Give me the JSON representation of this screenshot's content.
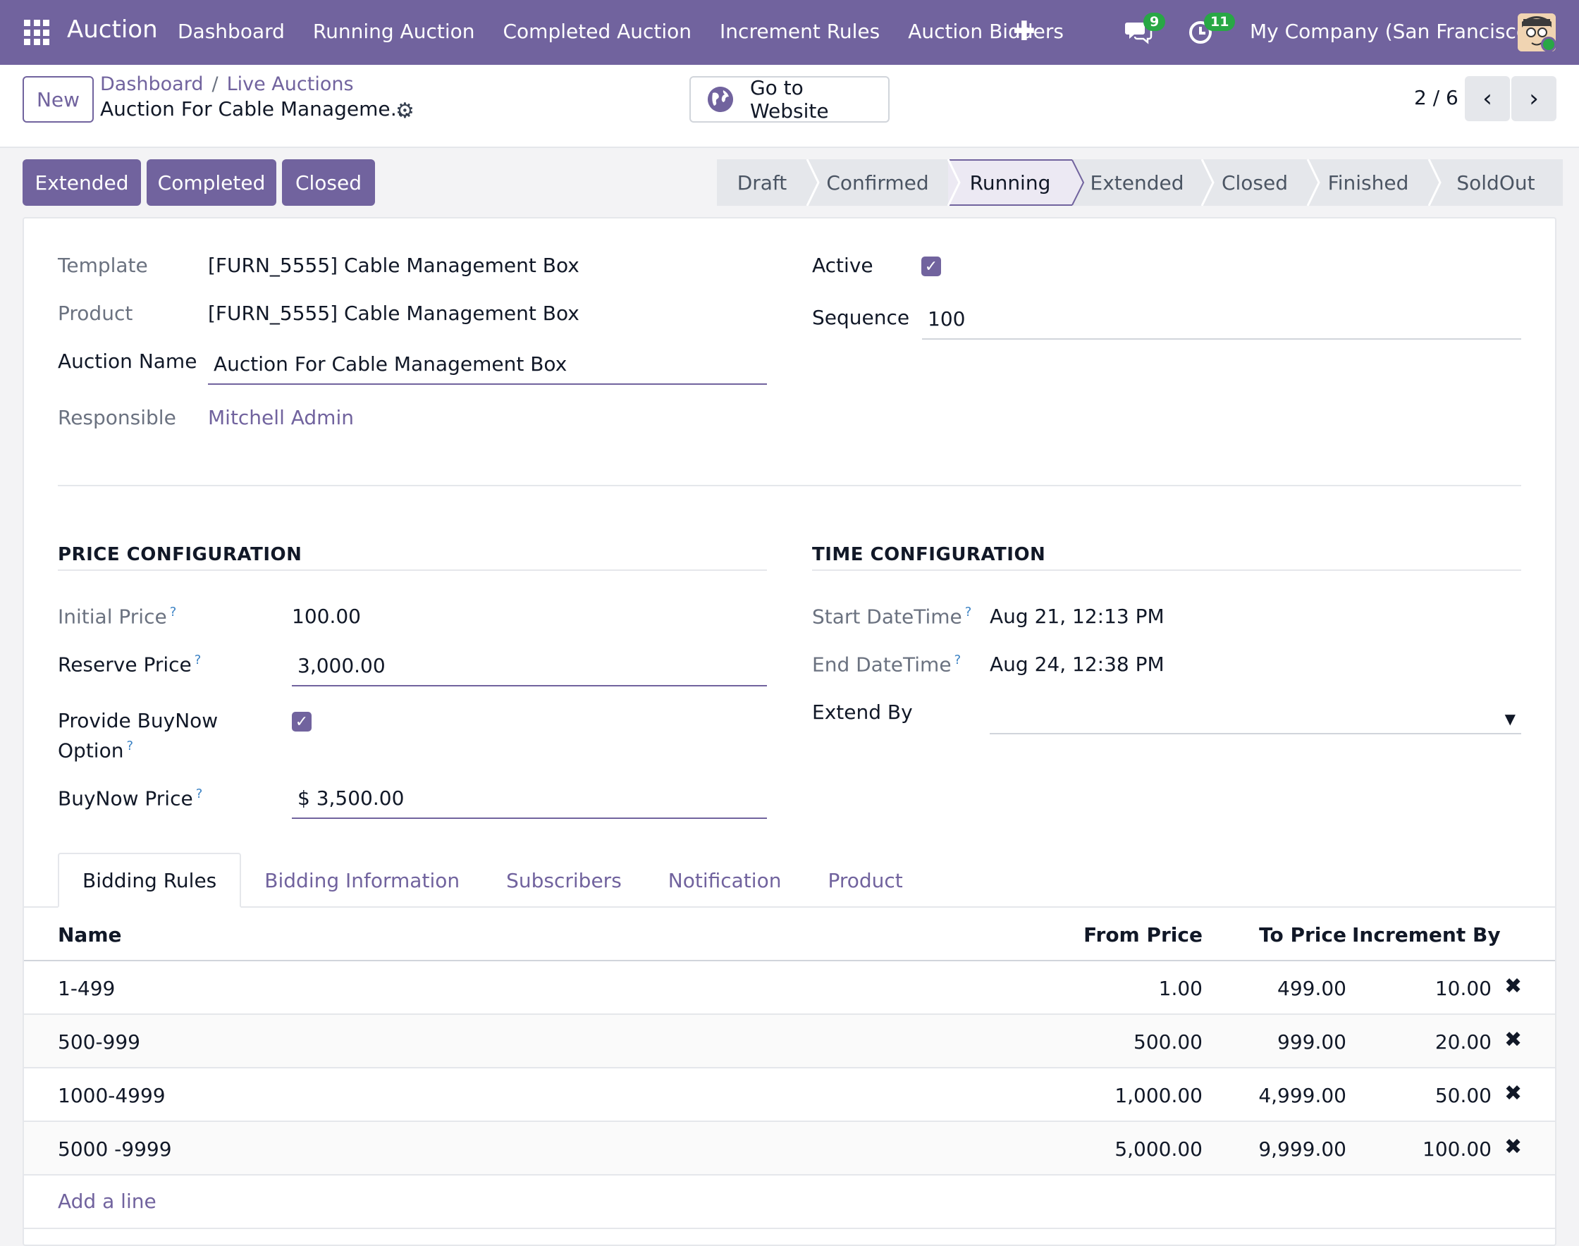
{
  "topnav": {
    "app_name": "Auction",
    "menu": [
      "Dashboard",
      "Running Auction",
      "Completed Auction",
      "Increment Rules",
      "Auction Bidders"
    ],
    "messages_count": "9",
    "activities_count": "11",
    "company": "My Company (San Francisco)"
  },
  "control": {
    "new_label": "New",
    "breadcrumb": [
      "Dashboard",
      "Live Auctions"
    ],
    "record_title": "Auction For Cable Manageme…",
    "website_label": "Go to Website",
    "pager": "2 / 6"
  },
  "actions": [
    "Extended",
    "Completed",
    "Closed"
  ],
  "stages": [
    "Draft",
    "Confirmed",
    "Running",
    "Extended",
    "Closed",
    "Finished",
    "SoldOut"
  ],
  "active_stage": "Running",
  "form": {
    "template_label": "Template",
    "template_value": "[FURN_5555] Cable Management Box",
    "product_label": "Product",
    "product_value": "[FURN_5555] Cable Management Box",
    "auction_name_label": "Auction Name",
    "auction_name_value": "Auction For Cable Management Box",
    "responsible_label": "Responsible",
    "responsible_value": "Mitchell Admin",
    "active_label": "Active",
    "active_checked": true,
    "sequence_label": "Sequence",
    "sequence_value": "100"
  },
  "price_config": {
    "title": "PRICE CONFIGURATION",
    "initial_price_label": "Initial Price",
    "initial_price_value": "100.00",
    "reserve_price_label": "Reserve Price",
    "reserve_price_value": "3,000.00",
    "buynow_option_label_1": "Provide BuyNow",
    "buynow_option_label_2": "Option",
    "buynow_checked": true,
    "buynow_price_label": "BuyNow Price",
    "buynow_price_value": "$ 3,500.00"
  },
  "time_config": {
    "title": "TIME CONFIGURATION",
    "start_label": "Start DateTime",
    "start_value": "Aug 21, 12:13 PM",
    "end_label": "End DateTime",
    "end_value": "Aug 24, 12:38 PM",
    "extend_label": "Extend By",
    "extend_value": ""
  },
  "tabs": [
    "Bidding Rules",
    "Bidding Information",
    "Subscribers",
    "Notification",
    "Product"
  ],
  "table": {
    "headers": {
      "name": "Name",
      "from": "From Price",
      "to": "To Price",
      "inc": "Increment By"
    },
    "rows": [
      {
        "name": "1-499",
        "from": "1.00",
        "to": "499.00",
        "inc": "10.00"
      },
      {
        "name": "500-999",
        "from": "500.00",
        "to": "999.00",
        "inc": "20.00"
      },
      {
        "name": "1000-4999",
        "from": "1,000.00",
        "to": "4,999.00",
        "inc": "50.00"
      },
      {
        "name": "5000 -9999",
        "from": "5,000.00",
        "to": "9,999.00",
        "inc": "100.00"
      }
    ],
    "add_line": "Add a line"
  },
  "help_mark": "?",
  "delete_glyph": "✖",
  "colors": {
    "brand": "#71639e",
    "badge": "#28a745",
    "link": "#71639e"
  }
}
